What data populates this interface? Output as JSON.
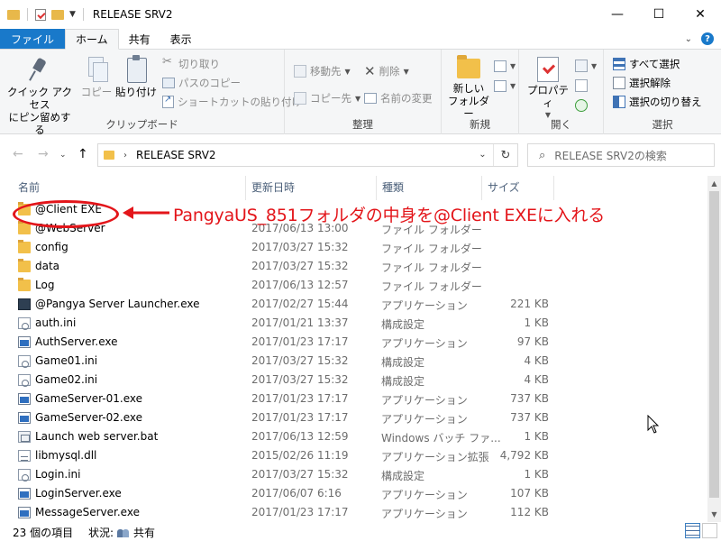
{
  "window": {
    "title": "RELEASE SRV2",
    "minimize_glyph": "—",
    "maximize_glyph": "☐",
    "close_glyph": "✕"
  },
  "tabs": {
    "file": "ファイル",
    "home": "ホーム",
    "share": "共有",
    "view": "表示"
  },
  "ribbon": {
    "clipboard": {
      "label": "クリップボード",
      "pin_line1": "クイック アクセス",
      "pin_line2": "にピン留めする",
      "copy": "コピー",
      "paste": "貼り付け",
      "cut": "切り取り",
      "copy_path": "パスのコピー",
      "paste_shortcut": "ショートカットの貼り付け"
    },
    "organize": {
      "label": "整理",
      "move_to": "移動先",
      "copy_to": "コピー先",
      "delete": "削除",
      "rename": "名前の変更"
    },
    "new": {
      "label": "新規",
      "new_folder_line1": "新しい",
      "new_folder_line2": "フォルダー"
    },
    "open": {
      "label": "開く",
      "properties": "プロパティ"
    },
    "select": {
      "label": "選択",
      "select_all": "すべて選択",
      "select_none": "選択解除",
      "invert": "選択の切り替え"
    }
  },
  "address": {
    "path": "RELEASE SRV2",
    "search_placeholder": "RELEASE SRV2の検索"
  },
  "columns": {
    "name": "名前",
    "date": "更新日時",
    "type": "種類",
    "size": "サイズ"
  },
  "files": [
    {
      "name": "@Client EXE",
      "date": "",
      "type": "",
      "size": "",
      "icon": "folder"
    },
    {
      "name": "@WebServer",
      "date": "2017/06/13 13:00",
      "type": "ファイル フォルダー",
      "size": "",
      "icon": "folder"
    },
    {
      "name": "config",
      "date": "2017/03/27 15:32",
      "type": "ファイル フォルダー",
      "size": "",
      "icon": "folder"
    },
    {
      "name": "data",
      "date": "2017/03/27 15:32",
      "type": "ファイル フォルダー",
      "size": "",
      "icon": "folder"
    },
    {
      "name": "Log",
      "date": "2017/06/13 12:57",
      "type": "ファイル フォルダー",
      "size": "",
      "icon": "folder"
    },
    {
      "name": "@Pangya Server Launcher.exe",
      "date": "2017/02/27 15:44",
      "type": "アプリケーション",
      "size": "221 KB",
      "icon": "launcher"
    },
    {
      "name": "auth.ini",
      "date": "2017/01/21 13:37",
      "type": "構成設定",
      "size": "1 KB",
      "icon": "ini"
    },
    {
      "name": "AuthServer.exe",
      "date": "2017/01/23 17:17",
      "type": "アプリケーション",
      "size": "97 KB",
      "icon": "app"
    },
    {
      "name": "Game01.ini",
      "date": "2017/03/27 15:32",
      "type": "構成設定",
      "size": "4 KB",
      "icon": "ini"
    },
    {
      "name": "Game02.ini",
      "date": "2017/03/27 15:32",
      "type": "構成設定",
      "size": "4 KB",
      "icon": "ini"
    },
    {
      "name": "GameServer-01.exe",
      "date": "2017/01/23 17:17",
      "type": "アプリケーション",
      "size": "737 KB",
      "icon": "app"
    },
    {
      "name": "GameServer-02.exe",
      "date": "2017/01/23 17:17",
      "type": "アプリケーション",
      "size": "737 KB",
      "icon": "app"
    },
    {
      "name": "Launch web server.bat",
      "date": "2017/06/13 12:59",
      "type": "Windows バッチ ファ...",
      "size": "1 KB",
      "icon": "bat"
    },
    {
      "name": "libmysql.dll",
      "date": "2015/02/26 11:19",
      "type": "アプリケーション拡張",
      "size": "4,792 KB",
      "icon": "dll"
    },
    {
      "name": "Login.ini",
      "date": "2017/03/27 15:32",
      "type": "構成設定",
      "size": "1 KB",
      "icon": "ini"
    },
    {
      "name": "LoginServer.exe",
      "date": "2017/06/07 6:16",
      "type": "アプリケーション",
      "size": "107 KB",
      "icon": "app"
    },
    {
      "name": "MessageServer.exe",
      "date": "2017/01/23 17:17",
      "type": "アプリケーション",
      "size": "112 KB",
      "icon": "app"
    }
  ],
  "annotation": {
    "text": "PangyaUS_851フォルダの中身を@Client EXEに入れる",
    "color": "#e3151a"
  },
  "status": {
    "count": "23 個の項目",
    "state_label": "状況:",
    "state_value": "共有"
  },
  "colors": {
    "file_tab": "#1979ca",
    "folder": "#f2c04a",
    "annotation": "#e3151a"
  }
}
